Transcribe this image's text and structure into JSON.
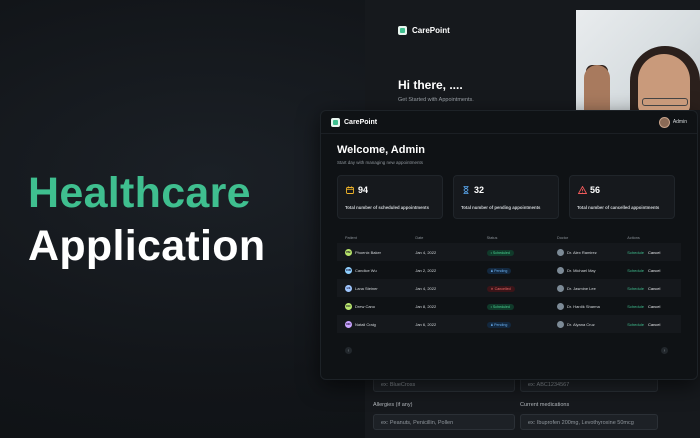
{
  "headline": {
    "line1": "Healthcare",
    "line2": "Application"
  },
  "back_screen": {
    "logo": "CarePoint",
    "greeting": "Hi there, ....",
    "subtitle": "Get Started with Appointments.",
    "inputs": [
      {
        "value": "ex: BlueCross"
      },
      {
        "value": "ex: ABC1234567"
      },
      {
        "value": "ex: Peanuts, Penicillin, Pollen"
      },
      {
        "value": "ex: Ibuprofen 200mg, Levothyroxine 50mcg"
      }
    ],
    "labels": {
      "allergies": "Allergies (if any)",
      "medications": "Current medications"
    }
  },
  "dashboard": {
    "logo": "CarePoint",
    "user": "Admin",
    "welcome": "Welcome, Admin",
    "welcome_sub": "Start day with managing new appointments",
    "stats": [
      {
        "value": "94",
        "label": "Total number of scheduled appointments",
        "icon": "calendar-icon",
        "color": "#f0b429"
      },
      {
        "value": "32",
        "label": "Total number of pending appointments",
        "icon": "hourglass-icon",
        "color": "#5aa8f0"
      },
      {
        "value": "56",
        "label": "Total number of cancelled appointments",
        "icon": "warning-icon",
        "color": "#f05a5a"
      }
    ],
    "table": {
      "headers": [
        "Patient",
        "Date",
        "Status",
        "Doctor",
        "Actions"
      ],
      "rows": [
        {
          "initials": "PB",
          "avatar_color": "#b6e36a",
          "patient": "Phoenix Baker",
          "date": "Jan 4, 2022",
          "status": "• Scheduled",
          "status_kind": "scheduled",
          "doctor": "Dr. Alex Ramirez"
        },
        {
          "initials": "CW",
          "avatar_color": "#8fd0ff",
          "patient": "Candice Wu",
          "date": "Jan 2, 2022",
          "status": "⧗ Pending",
          "status_kind": "pending",
          "doctor": "Dr. Michael May"
        },
        {
          "initials": "LS",
          "avatar_color": "#9fc7ff",
          "patient": "Lana Steiner",
          "date": "Jan 4, 2022",
          "status": "✕ Cancelled",
          "status_kind": "cancelled",
          "doctor": "Dr. Jasmine Lee"
        },
        {
          "initials": "DC",
          "avatar_color": "#b9e86f",
          "patient": "Drew Cano",
          "date": "Jan 8, 2022",
          "status": "• Scheduled",
          "status_kind": "scheduled",
          "doctor": "Dr. Hardik Sharma"
        },
        {
          "initials": "NC",
          "avatar_color": "#c9a3ff",
          "patient": "Natali Craig",
          "date": "Jan 6, 2022",
          "status": "⧗ Pending",
          "status_kind": "pending",
          "doctor": "Dr. Alyana Cruz"
        }
      ],
      "action_schedule": "Schedule",
      "action_cancel": "Cancel"
    },
    "pager": {
      "prev": "‹",
      "next": "›"
    }
  }
}
